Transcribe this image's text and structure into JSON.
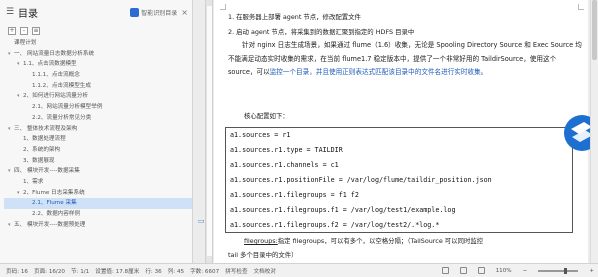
{
  "nav": {
    "title": "目录",
    "smart_label": "智能识别目录",
    "tools": [
      "+",
      "-",
      "≡"
    ],
    "items": [
      {
        "label": "课程计划",
        "level": 0,
        "caret": ""
      },
      {
        "label": "一、 网站流量日志数据分析系统",
        "level": 0,
        "caret": "▾"
      },
      {
        "label": "1.1、点击流数据模型",
        "level": 1,
        "caret": "▾"
      },
      {
        "label": "1.1.1、点击流概念",
        "level": 2,
        "caret": ""
      },
      {
        "label": "1.1.2、点击流模型生成",
        "level": 2,
        "caret": ""
      },
      {
        "label": "2、如何进行网站流量分析",
        "level": 1,
        "caret": "▾"
      },
      {
        "label": "2.1、网站流量分析模型举例",
        "level": 2,
        "caret": ""
      },
      {
        "label": "2.2、流量分析常见分类",
        "level": 2,
        "caret": ""
      },
      {
        "label": "三、 整体技术流程及架构",
        "level": 0,
        "caret": "▾"
      },
      {
        "label": "1、数据处理流程",
        "level": 1,
        "caret": ""
      },
      {
        "label": "2、系统的架构",
        "level": 1,
        "caret": ""
      },
      {
        "label": "3、数据展现",
        "level": 1,
        "caret": ""
      },
      {
        "label": "四、 模块开发----数据采集",
        "level": 0,
        "caret": "▾"
      },
      {
        "label": "1、需求",
        "level": 1,
        "caret": ""
      },
      {
        "label": "2、Flume 日志采集系统",
        "level": 1,
        "caret": "▾"
      },
      {
        "label": "2.1、Flume 采集",
        "level": 2,
        "caret": "",
        "active": true
      },
      {
        "label": "2.2、数据内容样例",
        "level": 2,
        "caret": ""
      },
      {
        "label": "五、 模块开发----数据预处理",
        "level": 0,
        "caret": "▾"
      }
    ]
  },
  "doc": {
    "bullet1": "1. 在服务器上部署 agent 节点，修改配置文件",
    "bullet2": "2. 启动 agent 节点，将采集到的数据汇聚到指定的 HDFS 目录中",
    "para_a": "针对 nginx 日志生成场景，如果通过 flume（1.6）收集，无论是 Spooling Directory Source 和 Exec Source 均不能满足动态实时收集的需求，在当前 flume1.7 稳定版本中，提供了一个非常好用的 TaildirSource，使用这个 source，可以",
    "para_hl": "监控一个目录，并且使用正则表达式匹配该目录中的文件名进行实时收集。",
    "config_label": "核心配置如下：",
    "code": [
      "a1.sources = r1",
      "a1.sources.r1.type = TAILDIR",
      "a1.sources.r1.channels = c1",
      "a1.sources.r1.positionFile = /var/log/flume/taildir_position.json",
      "a1.sources.r1.filegroups = f1 f2",
      "a1.sources.r1.filegroups.f1 = /var/log/test1/example.log",
      "a1.sources.r1.filegroups.f2 = /var/log/test2/.*log.*"
    ],
    "filegroups_term": "filegroups:",
    "filegroups_text": "指定 filegroups，可以有多个，以空格分隔；（TailSource 可以同时监控",
    "tail_line": "tail 多个目录中的文件）"
  },
  "status": {
    "page": "页码: 16",
    "pages": "页面: 16/20",
    "section": "节: 1/1",
    "settings": "设置值: 17.8厘米",
    "row": "行: 36",
    "col": "列: 45",
    "words": "字数: 6607",
    "spell": "拼写检查",
    "doc_check": "文档校对",
    "zoom": "110%"
  },
  "colors": {
    "accent": "#1e5bb8",
    "active_bg": "#cfe1f7"
  }
}
